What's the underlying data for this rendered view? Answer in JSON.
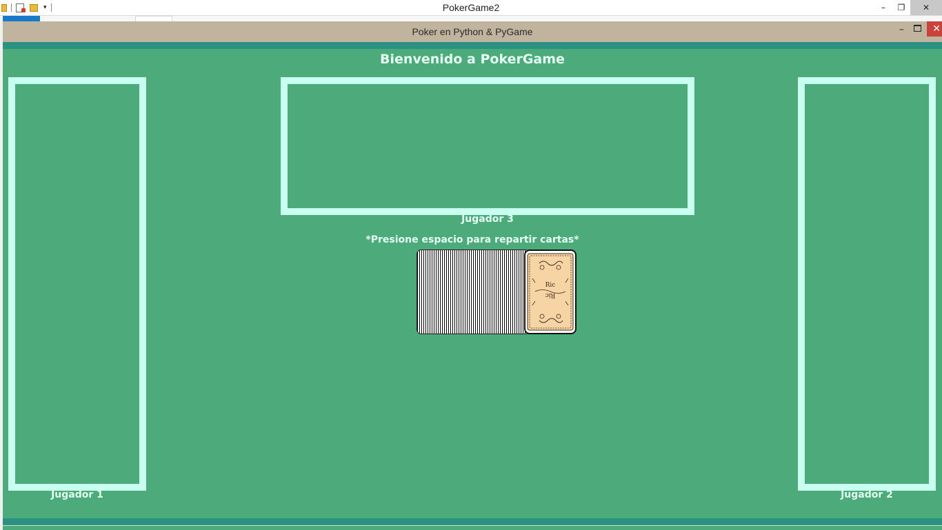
{
  "outer_window": {
    "title": "PokerGame2",
    "controls": {
      "minimize": "–",
      "restore": "❐",
      "close": "✕"
    }
  },
  "game_window": {
    "title": "Poker en Python & PyGame",
    "controls": {
      "minimize": "–",
      "close": "✕"
    }
  },
  "table": {
    "welcome": "Bienvenido a PokerGame",
    "hint": "*Presione espacio para repartir cartas*",
    "players": {
      "p1": "Jugador 1",
      "p2": "Jugador 2",
      "p3": "Jugador 3"
    },
    "card_back_text": "Ric"
  },
  "colors": {
    "felt": "#4caa7b",
    "box_border": "#c8fff0",
    "teal_band": "#2b9181",
    "card_back": "#f7d4a3"
  }
}
